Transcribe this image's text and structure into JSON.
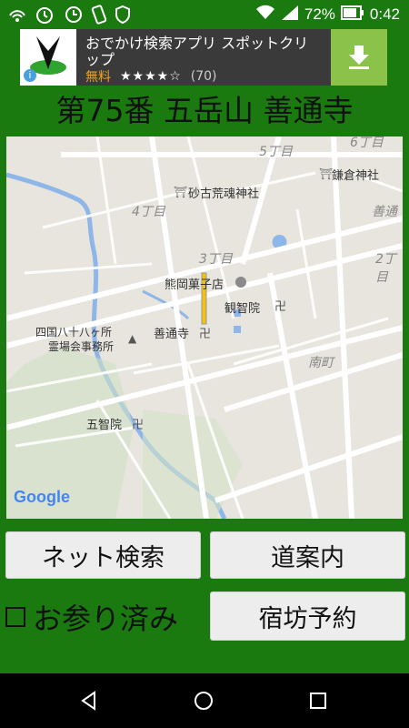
{
  "status": {
    "battery": "72%",
    "time": "0:42"
  },
  "ad": {
    "title_line1": "おでかけ検索アプリ スポットクリ",
    "title_line2": "ップ",
    "price": "無料",
    "stars": "★★★★☆",
    "reviews": "(70)"
  },
  "page": {
    "title": "第75番 五岳山 善通寺"
  },
  "map": {
    "labels": {
      "chome5": "5丁目",
      "chome6": "6丁目",
      "kamakura": "鎌倉神社",
      "sako": "砂古荒魂神社",
      "chome4": "4丁目",
      "zentsu_area": "善通",
      "chome3": "3丁目",
      "chome2": "2丁目",
      "kumaoka": "熊岡菓子店",
      "kanchi": "観智院",
      "shikoku_l1": "四国八十八ヶ所",
      "shikoku_l2": "霊場会事務所",
      "zentsuji": "善通寺",
      "minamimachi": "南町",
      "gochi": "五智院",
      "google": "Google"
    }
  },
  "buttons": {
    "net_search": "ネット検索",
    "directions": "道案内",
    "lodging": "宿坊予約"
  },
  "checkbox": {
    "label": "お参り済み",
    "checked": false
  }
}
